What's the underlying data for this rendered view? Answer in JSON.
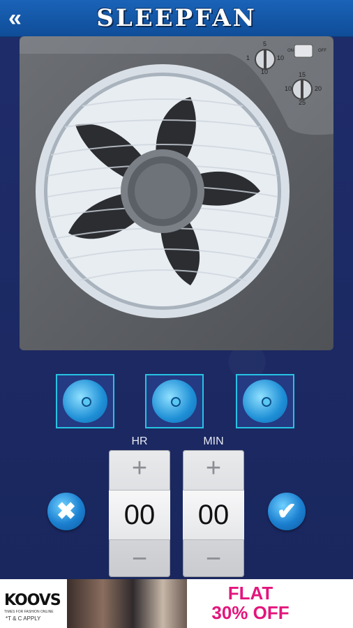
{
  "header": {
    "back_label": "«",
    "title": "SLEEPFAN"
  },
  "fan": {
    "timer_dial_labels": [
      "5",
      "1",
      "10",
      "10"
    ],
    "speed_dial_labels": [
      "15",
      "10",
      "20",
      "25"
    ],
    "switch_on": "ON",
    "switch_off": "OFF"
  },
  "speed_buttons": [
    {
      "name": "speed-1"
    },
    {
      "name": "speed-2"
    },
    {
      "name": "speed-3"
    }
  ],
  "timer": {
    "hr_label": "HR",
    "min_label": "MIN",
    "hr_value": "00",
    "min_value": "00",
    "plus": "+",
    "minus": "−"
  },
  "actions": {
    "cancel": "✖",
    "confirm": "✔"
  },
  "ad": {
    "brand": "KOOVS",
    "tagline": "TIMES FOR FASHION ONLINE",
    "tc": "*T & C APPLY",
    "offer_line1": "FLAT",
    "offer_line2": "30% OFF"
  },
  "colors": {
    "accent": "#27c3e3",
    "header": "#1a63b8",
    "background": "#1d2a66",
    "offer": "#e3157c"
  }
}
